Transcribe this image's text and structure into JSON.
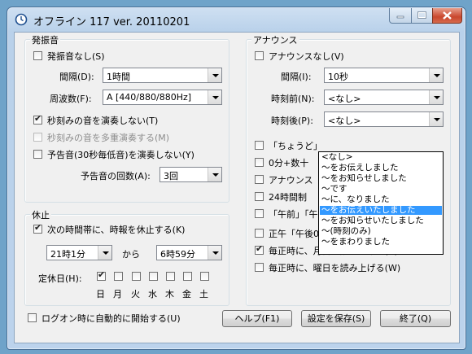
{
  "window": {
    "title": "オフライン 117 ver. 20110201"
  },
  "hassinon": {
    "group_label": "発振音",
    "no_beep_label": "発振音なし(S)",
    "interval_label": "間隔(D):",
    "interval_value": "1時間",
    "frequency_label": "周波数(F):",
    "frequency_value": "A [440/880/880Hz]",
    "no_second_beep_label": "秒刻みの音を演奏しない(T)",
    "no_multi_beep_label": "秒刻みの音を多重演奏する(M)",
    "no_pre_beep_label": "予告音(30秒毎低音)を演奏しない(Y)",
    "pre_beep_count_label": "予告音の回数(A):",
    "pre_beep_count_value": "3回"
  },
  "kyushi": {
    "group_label": "休止",
    "pause_label": "次の時間帯に、時報を休止する(K)",
    "from_value": "21時1分",
    "kara_label": "から",
    "to_value": "6時59分",
    "holiday_label": "定休日(H):",
    "days": [
      "日",
      "月",
      "火",
      "水",
      "木",
      "金",
      "土"
    ]
  },
  "announce": {
    "group_label": "アナウンス",
    "no_announce_label": "アナウンスなし(V)",
    "interval_label": "間隔(I):",
    "interval_value": "10秒",
    "before_label": "時刻前(N):",
    "before_value": "<なし>",
    "after_label": "時刻後(P):",
    "after_value": "<なし>",
    "opt_chodo_label": "「ちょうど」",
    "opt_zero_label": "0分+数十",
    "opt_announce_label": "アナウンス",
    "opt_24h_label": "24時間制",
    "opt_gozen_label": "「午前」「午",
    "opt_noon_label": "正午「午後0時」を「午後12時」とする(R)",
    "opt_month_label": "毎正時に、月日を読み上げる(C)",
    "opt_weekday_label": "毎正時に、曜日を読み上げる(W)",
    "dropdown_options": [
      "<なし>",
      "〜をお伝えしました",
      "〜をお知らせしました",
      "〜です",
      "〜に、なりました",
      "〜をお伝えいたしました",
      "〜をお知らせいたしました",
      "〜(時刻のみ)",
      "〜をまわりました"
    ],
    "dropdown_selected_index": 5
  },
  "footer": {
    "autostart_label": "ログオン時に自動的に開始する(U)",
    "help_label": "ヘルプ(F1)",
    "save_label": "設定を保存(S)",
    "exit_label": "終了(Q)"
  }
}
